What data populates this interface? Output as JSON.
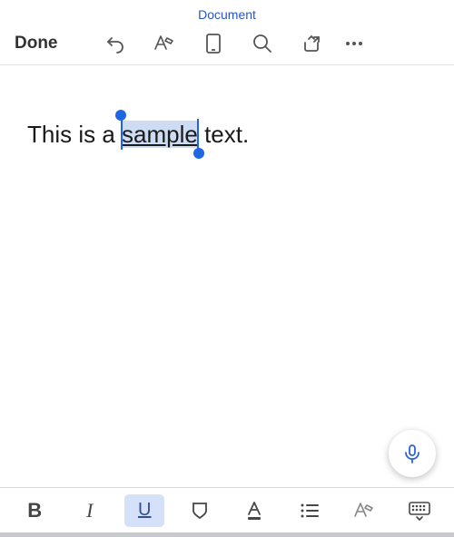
{
  "title": "Document",
  "toolbar": {
    "done": "Done"
  },
  "content": {
    "pre": "This is a ",
    "selected": "sample",
    "post": " text."
  },
  "format": {
    "bold": "B",
    "italic": "I",
    "underline": "U"
  }
}
